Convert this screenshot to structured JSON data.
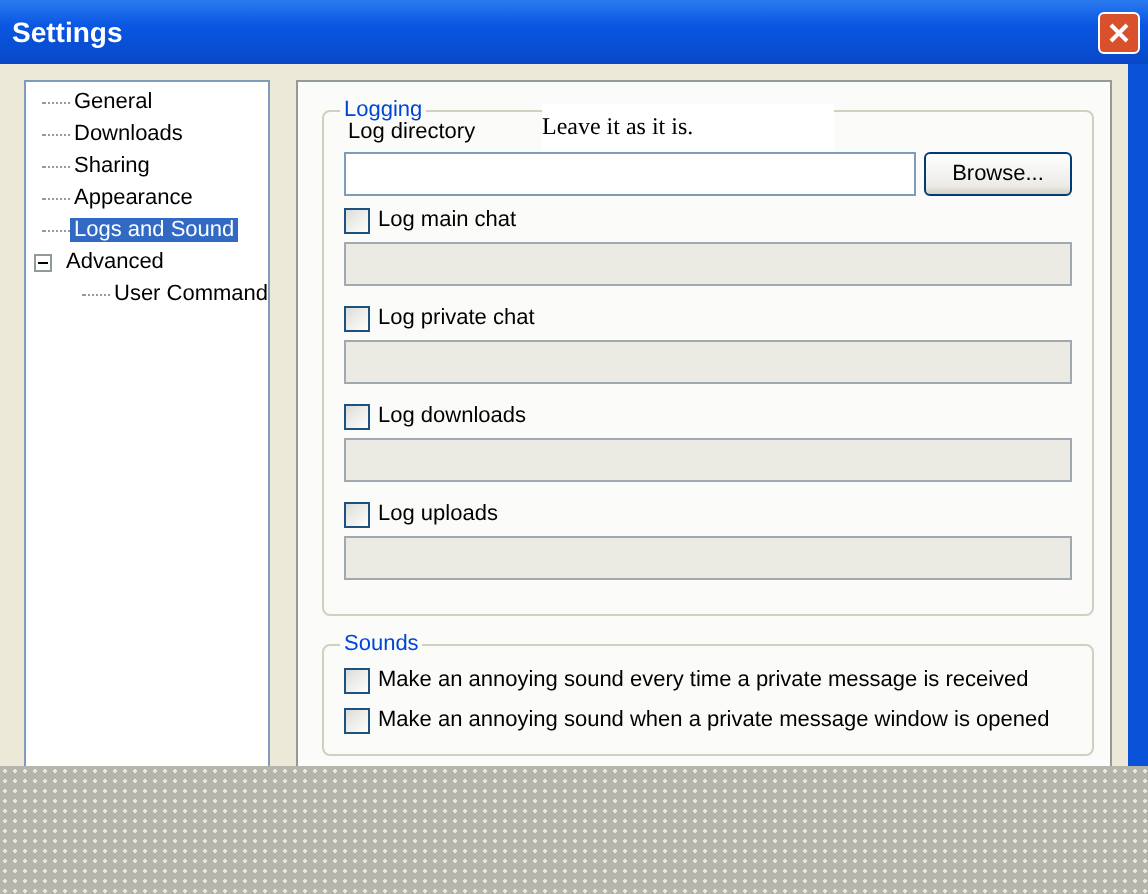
{
  "window": {
    "title": "Settings"
  },
  "tree": [
    {
      "label": "General",
      "selected": false
    },
    {
      "label": "Downloads",
      "selected": false
    },
    {
      "label": "Sharing",
      "selected": false
    },
    {
      "label": "Appearance",
      "selected": false
    },
    {
      "label": "Logs and Sound",
      "selected": true
    },
    {
      "label": "Advanced",
      "selected": false,
      "expanded": true,
      "children": [
        {
          "label": "User Command",
          "selected": false
        }
      ]
    }
  ],
  "note": "Leave it as it is.",
  "logging": {
    "legend": "Logging",
    "directory_label": "Log directory",
    "browse_button": "Browse...",
    "options": [
      {
        "label": "Log main chat",
        "checked": false
      },
      {
        "label": "Log private chat",
        "checked": false
      },
      {
        "label": "Log downloads",
        "checked": false
      },
      {
        "label": "Log uploads",
        "checked": false
      }
    ]
  },
  "sounds": {
    "legend": "Sounds",
    "options": [
      {
        "label": "Make an annoying sound every time a private message is received",
        "checked": false
      },
      {
        "label": "Make an annoying sound when a private message window is opened",
        "checked": false
      }
    ]
  }
}
